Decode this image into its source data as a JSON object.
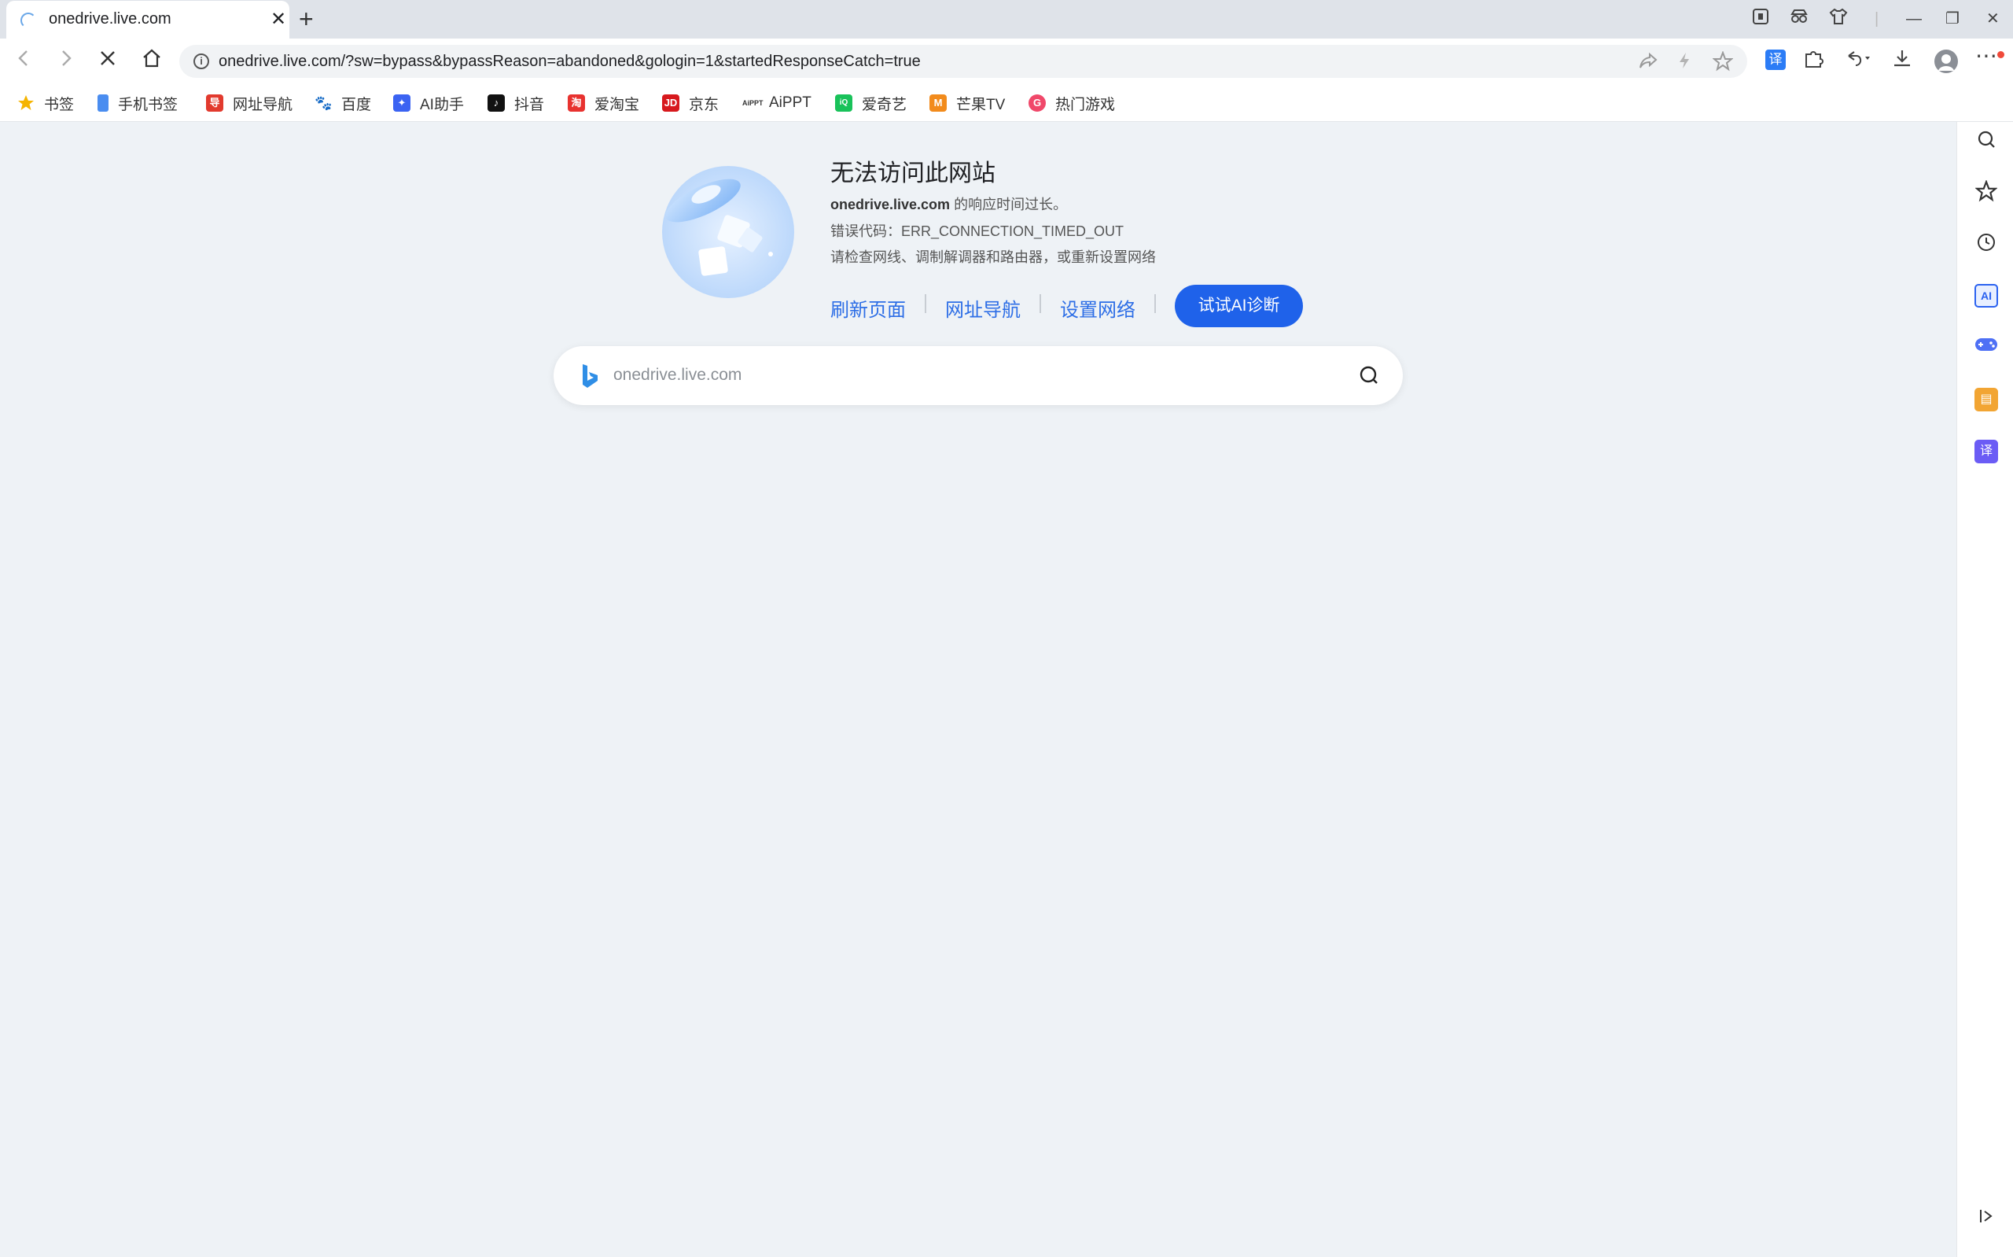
{
  "tab": {
    "title": "onedrive.live.com",
    "close_icon": "close-icon",
    "new_tab_label": "+"
  },
  "window_controls": {
    "minimize": "—",
    "maximize": "❐",
    "close": "✕"
  },
  "toolbar": {
    "url": "onedrive.live.com/?sw=bypass&bypassReason=abandoned&gologin=1&startedResponseCatch=true",
    "translate_label": "译"
  },
  "bookmarks": [
    {
      "label": "书签",
      "icon": "star-icon",
      "color": "#f5b400"
    },
    {
      "label": "手机书签",
      "icon": "phone-icon",
      "color": "#4a8df0"
    },
    {
      "label": "网址导航",
      "icon": "nav-icon",
      "color": "#e23a2e"
    },
    {
      "label": "百度",
      "icon": "baidu-icon",
      "color": "#2f4be0"
    },
    {
      "label": "AI助手",
      "icon": "ai-assistant-icon",
      "color": "#3b63f2"
    },
    {
      "label": "抖音",
      "icon": "douyin-icon",
      "color": "#111111"
    },
    {
      "label": "爱淘宝",
      "icon": "taobao-icon",
      "color": "#e8322f"
    },
    {
      "label": "京东",
      "icon": "jd-icon",
      "color": "#d7191d"
    },
    {
      "label": "AiPPT",
      "icon": "aippt-icon",
      "color": "#444444"
    },
    {
      "label": "爱奇艺",
      "icon": "iqiyi-icon",
      "color": "#19c25a"
    },
    {
      "label": "芒果TV",
      "icon": "mango-icon",
      "color": "#f28b1c"
    },
    {
      "label": "热门游戏",
      "icon": "games-icon",
      "color": "#f0486a"
    }
  ],
  "error": {
    "title": "无法访问此网站",
    "host": "onedrive.live.com",
    "host_suffix": " 的响应时间过长。",
    "code_line": "错误代码：ERR_CONNECTION_TIMED_OUT",
    "hint_line": "请检查网线、调制解调器和路由器，或重新设置网络",
    "actions": [
      "刷新页面",
      "网址导航",
      "设置网络"
    ],
    "ai_button": "试试AI诊断"
  },
  "search": {
    "placeholder": "onedrive.live.com"
  },
  "sidebar": {
    "ai_label": "AI",
    "translate_label": "译"
  }
}
